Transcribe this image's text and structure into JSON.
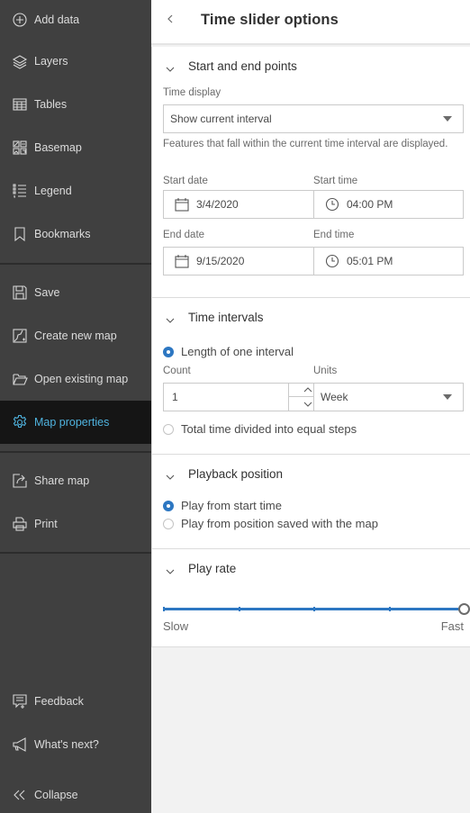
{
  "sidebar": {
    "items": [
      {
        "label": "Add data",
        "icon": "plus-circle-icon"
      },
      {
        "label": "Layers",
        "icon": "layers-icon"
      },
      {
        "label": "Tables",
        "icon": "table-icon"
      },
      {
        "label": "Basemap",
        "icon": "basemap-icon"
      },
      {
        "label": "Legend",
        "icon": "legend-icon"
      },
      {
        "label": "Bookmarks",
        "icon": "bookmark-icon"
      },
      {
        "label": "Save",
        "icon": "save-icon"
      },
      {
        "label": "Create new map",
        "icon": "new-map-icon"
      },
      {
        "label": "Open existing map",
        "icon": "folder-open-icon"
      },
      {
        "label": "Map properties",
        "icon": "gear-icon",
        "active": true
      },
      {
        "label": "Share map",
        "icon": "share-icon"
      },
      {
        "label": "Print",
        "icon": "print-icon"
      }
    ],
    "footer": [
      {
        "label": "Feedback",
        "icon": "feedback-icon"
      },
      {
        "label": "What's next?",
        "icon": "megaphone-icon"
      },
      {
        "label": "Collapse",
        "icon": "double-chevron-left-icon"
      }
    ],
    "accent_color": "#4fb3df"
  },
  "panel": {
    "title": "Time slider options",
    "back_icon": "chevron-left-icon",
    "start_end": {
      "title": "Start and end points",
      "time_display_label": "Time display",
      "time_display_value": "Show current interval",
      "help_text": "Features that fall within the current time interval are displayed.",
      "start_date_label": "Start date",
      "start_date": "3/4/2020",
      "start_time_label": "Start time",
      "start_time": "04:00 PM",
      "end_date_label": "End date",
      "end_date": "9/15/2020",
      "end_time_label": "End time",
      "end_time": "05:01 PM"
    },
    "time_intervals": {
      "title": "Time intervals",
      "option_length": "Length of one interval",
      "count_label": "Count",
      "count_value": "1",
      "units_label": "Units",
      "units_value": "Week",
      "option_total": "Total time divided into equal steps",
      "selected": "length"
    },
    "playback": {
      "title": "Playback position",
      "option_start": "Play from start time",
      "option_saved": "Play from position saved with the map",
      "selected": "start"
    },
    "play_rate": {
      "title": "Play rate",
      "slow_label": "Slow",
      "fast_label": "Fast",
      "steps": 5,
      "value_step": 4,
      "accent_color": "#2d77c2"
    }
  }
}
